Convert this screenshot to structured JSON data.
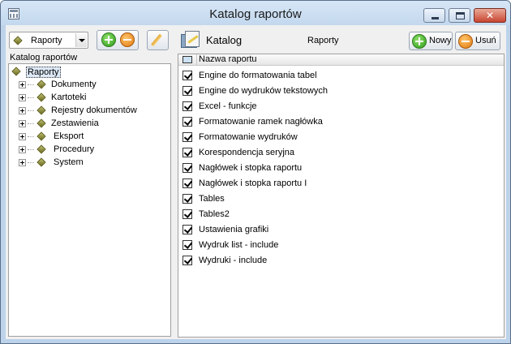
{
  "window": {
    "title": "Katalog raportów",
    "close_glyph": "✕"
  },
  "left": {
    "combo_value": "Raporty",
    "panel_label": "Katalog raportów",
    "tree": [
      {
        "label": "Raporty",
        "expanded": true,
        "selected": true
      },
      {
        "label": "Dokumenty"
      },
      {
        "label": "Kartoteki"
      },
      {
        "label": "Rejestry dokumentów"
      },
      {
        "label": "Zestawienia"
      },
      {
        "label": "Eksport"
      },
      {
        "label": "Procedury"
      },
      {
        "label": "System"
      }
    ]
  },
  "right": {
    "title": "Katalog",
    "subtitle": "Raporty",
    "new_button": "Nowy",
    "delete_button": "Usuń",
    "column_header": "Nazwa raportu",
    "rows": [
      "Engine do formatowania tabel",
      "Engine do wydruków tekstowych",
      "Excel - funkcje",
      "Formatowanie ramek nagłówka",
      "Formatowanie wydruków",
      "Korespondencja seryjna",
      "Nagłówek i stopka raportu",
      "Nagłówek i stopka raportu I",
      "Tables",
      "Tables2",
      "Ustawienia grafiki",
      "Wydruk list - include",
      "Wydruki - include"
    ]
  },
  "colors": {
    "frame": "#bcd3ea",
    "client": "#f0f0f0",
    "close_button": "#c8452f",
    "add_icon": "#2e9b1a",
    "remove_icon": "#e07a10"
  }
}
